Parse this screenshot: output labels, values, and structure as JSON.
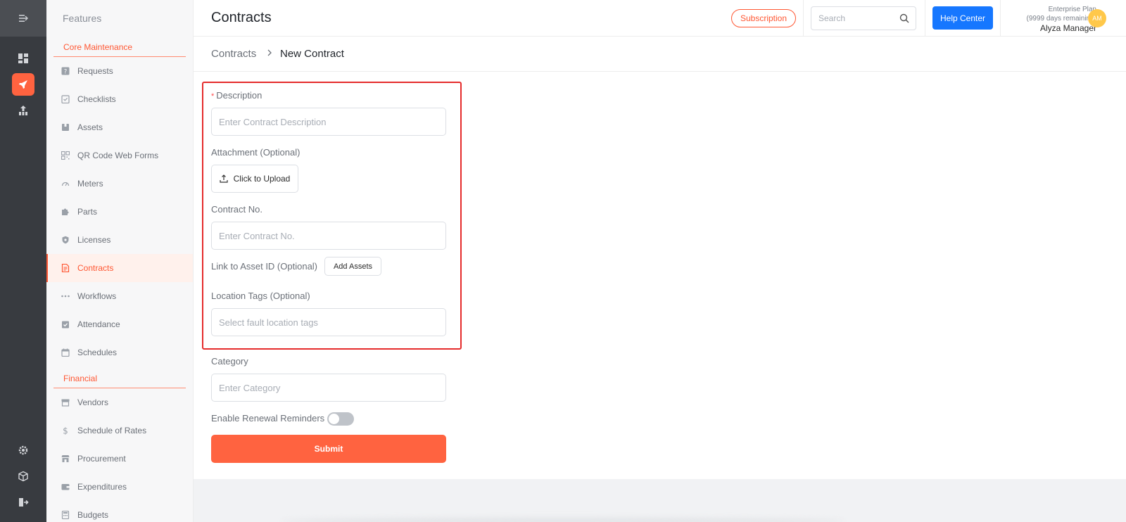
{
  "sidebar": {
    "title": "Features",
    "sections": [
      {
        "label": "Core Maintenance",
        "items": [
          {
            "label": "Requests",
            "icon": "question-square-icon"
          },
          {
            "label": "Checklists",
            "icon": "checklist-icon"
          },
          {
            "label": "Assets",
            "icon": "box-icon"
          },
          {
            "label": "QR Code Web Forms",
            "icon": "qr-code-icon"
          },
          {
            "label": "Meters",
            "icon": "gauge-icon"
          },
          {
            "label": "Parts",
            "icon": "puzzle-icon"
          },
          {
            "label": "Licenses",
            "icon": "shield-icon"
          },
          {
            "label": "Contracts",
            "icon": "contract-icon",
            "active": true
          },
          {
            "label": "Workflows",
            "icon": "dots-icon"
          },
          {
            "label": "Attendance",
            "icon": "check-calendar-icon"
          },
          {
            "label": "Schedules",
            "icon": "calendar-icon"
          }
        ]
      },
      {
        "label": "Financial",
        "items": [
          {
            "label": "Vendors",
            "icon": "store-icon"
          },
          {
            "label": "Schedule of Rates",
            "icon": "dollar-icon"
          },
          {
            "label": "Procurement",
            "icon": "shop-icon"
          },
          {
            "label": "Expenditures",
            "icon": "wallet-icon"
          },
          {
            "label": "Budgets",
            "icon": "calculator-icon"
          }
        ]
      }
    ]
  },
  "header": {
    "title": "Contracts",
    "subscription_label": "Subscription",
    "search_placeholder": "Search",
    "help_label": "Help Center",
    "plan_name": "Enterprise Plan",
    "plan_days": "(9999 days remaining)",
    "user_name": "Alyza Manager",
    "avatar_initials": "AM"
  },
  "breadcrumb": {
    "parent": "Contracts",
    "current": "New Contract"
  },
  "form": {
    "description_label": "Description",
    "description_placeholder": "Enter Contract Description",
    "attachment_label": "Attachment (Optional)",
    "upload_label": "Click to Upload",
    "contract_no_label": "Contract No.",
    "contract_no_placeholder": "Enter Contract No.",
    "asset_link_label": "Link to Asset ID (Optional)",
    "add_assets_label": "Add Assets",
    "location_label": "Location Tags (Optional)",
    "location_placeholder": "Select fault location tags",
    "category_label": "Category",
    "category_placeholder": "Enter Category",
    "renewal_label": "Enable Renewal Reminders",
    "renewal_enabled": false,
    "submit_label": "Submit"
  },
  "colors": {
    "accent": "#ff6340",
    "rail": "#383b40",
    "primary_blue": "#1677ff",
    "highlight_border": "#e52b2b"
  }
}
